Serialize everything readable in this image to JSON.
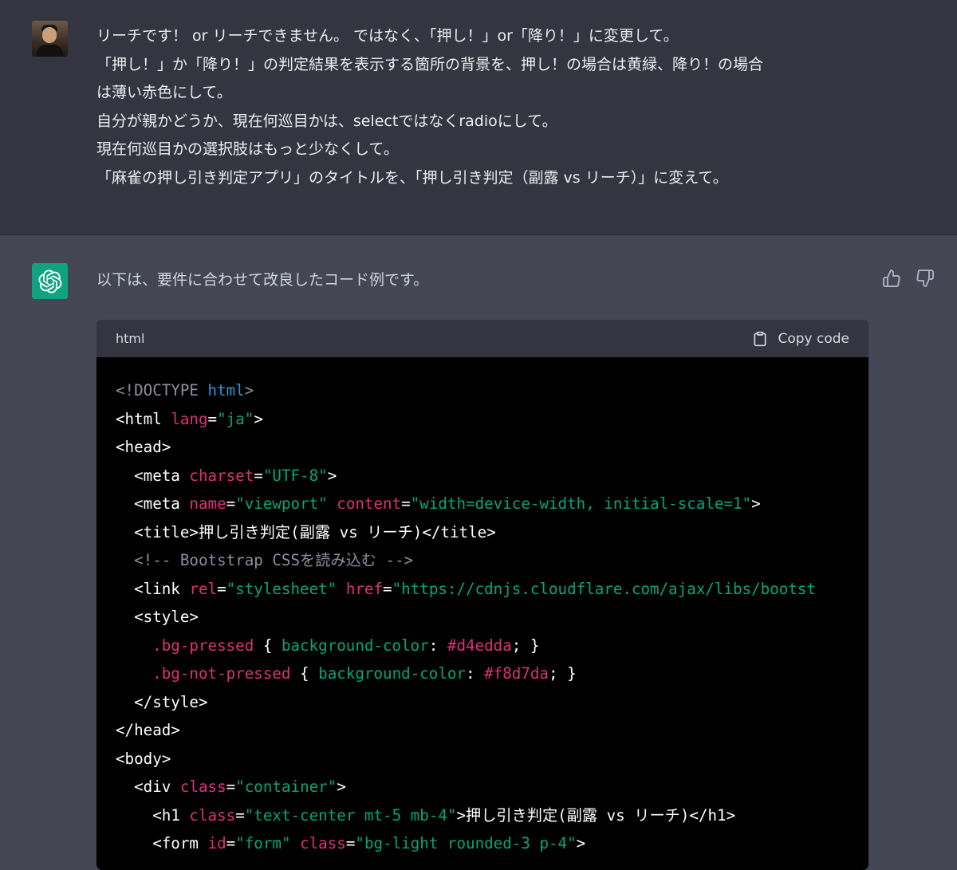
{
  "user_message": {
    "lines": [
      "リーチです！ or リーチできません。 ではなく、「押し！」or「降り！」に変更して。",
      "「押し！」か「降り！」の判定結果を表示する箇所の背景を、押し！の場合は黄緑、降り！の場合",
      "は薄い赤色にして。",
      "自分が親かどうか、現在何巡目かは、selectではなくradioにして。",
      "現在何巡目かの選択肢はもっと少なくして。",
      "「麻雀の押し引き判定アプリ」のタイトルを、「押し引き判定（副露 vs リーチ）」に変えて。"
    ]
  },
  "assistant_message": {
    "intro": "以下は、要件に合わせて改良したコード例です。"
  },
  "code_block": {
    "language": "html",
    "copy_label": "Copy code",
    "lines": [
      [
        [
          "t-doc",
          "<!DOCTYPE "
        ],
        [
          "t-kw",
          "html"
        ],
        [
          "t-doc",
          ">"
        ]
      ],
      [
        [
          "t-tag",
          "<html "
        ],
        [
          "t-attr",
          "lang"
        ],
        [
          "t-tag",
          "="
        ],
        [
          "t-str",
          "\"ja\""
        ],
        [
          "t-tag",
          ">"
        ]
      ],
      [
        [
          "t-tag",
          "<head>"
        ]
      ],
      [
        [
          "t-tag",
          "  <meta "
        ],
        [
          "t-attr",
          "charset"
        ],
        [
          "t-tag",
          "="
        ],
        [
          "t-str",
          "\"UTF-8\""
        ],
        [
          "t-tag",
          ">"
        ]
      ],
      [
        [
          "t-tag",
          "  <meta "
        ],
        [
          "t-attr",
          "name"
        ],
        [
          "t-tag",
          "="
        ],
        [
          "t-str",
          "\"viewport\" "
        ],
        [
          "t-attr",
          "content"
        ],
        [
          "t-tag",
          "="
        ],
        [
          "t-str",
          "\"width=device-width, initial-scale=1\""
        ],
        [
          "t-tag",
          ">"
        ]
      ],
      [
        [
          "t-tag",
          "  <title>押し引き判定(副露 vs リーチ)</title>"
        ]
      ],
      [
        [
          "t-com",
          "  <!-- Bootstrap CSSを読み込む -->"
        ]
      ],
      [
        [
          "t-tag",
          "  <link "
        ],
        [
          "t-attr",
          "rel"
        ],
        [
          "t-tag",
          "="
        ],
        [
          "t-str",
          "\"stylesheet\" "
        ],
        [
          "t-attr",
          "href"
        ],
        [
          "t-tag",
          "="
        ],
        [
          "t-str",
          "\"https://cdnjs.cloudflare.com/ajax/libs/bootst"
        ]
      ],
      [
        [
          "t-tag",
          "  <style>"
        ]
      ],
      [
        [
          "t-sel",
          "    .bg-pressed"
        ],
        [
          "t-tag",
          " { "
        ],
        [
          "t-prop",
          "background-color"
        ],
        [
          "t-tag",
          ": "
        ],
        [
          "t-val",
          "#d4edda"
        ],
        [
          "t-tag",
          "; }"
        ]
      ],
      [
        [
          "t-sel",
          "    .bg-not-pressed"
        ],
        [
          "t-tag",
          " { "
        ],
        [
          "t-prop",
          "background-color"
        ],
        [
          "t-tag",
          ": "
        ],
        [
          "t-val",
          "#f8d7da"
        ],
        [
          "t-tag",
          "; }"
        ]
      ],
      [
        [
          "t-tag",
          "  </style>"
        ]
      ],
      [
        [
          "t-tag",
          "</head>"
        ]
      ],
      [
        [
          "t-tag",
          "<body>"
        ]
      ],
      [
        [
          "t-tag",
          "  <div "
        ],
        [
          "t-attr",
          "class"
        ],
        [
          "t-tag",
          "="
        ],
        [
          "t-str",
          "\"container\""
        ],
        [
          "t-tag",
          ">"
        ]
      ],
      [
        [
          "t-tag",
          "    <h1 "
        ],
        [
          "t-attr",
          "class"
        ],
        [
          "t-tag",
          "="
        ],
        [
          "t-str",
          "\"text-center mt-5 mb-4\""
        ],
        [
          "t-tag",
          ">押し引き判定(副露 vs リーチ)</h1>"
        ]
      ],
      [
        [
          "t-tag",
          "    <form "
        ],
        [
          "t-attr",
          "id"
        ],
        [
          "t-tag",
          "="
        ],
        [
          "t-str",
          "\"form\" "
        ],
        [
          "t-attr",
          "class"
        ],
        [
          "t-tag",
          "="
        ],
        [
          "t-str",
          "\"bg-light rounded-3 p-4\""
        ],
        [
          "t-tag",
          ">"
        ]
      ]
    ]
  },
  "icons": {
    "thumbs_up": "thumbs-up-icon",
    "thumbs_down": "thumbs-down-icon",
    "clipboard": "clipboard-icon",
    "chatgpt_logo": "openai-logo-icon"
  },
  "colors": {
    "user_bg": "#343541",
    "assistant_bg": "#444654",
    "gpt_green": "#10a37f",
    "code_bg": "#000000"
  }
}
